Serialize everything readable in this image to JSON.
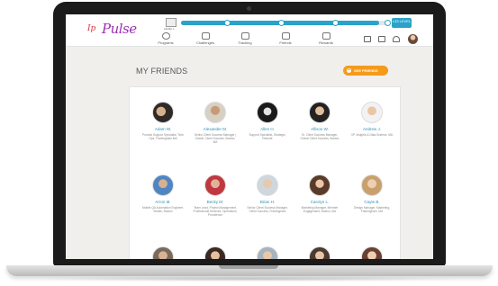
{
  "app": {
    "logo_mark": "Ip",
    "logo_text": "Pulse",
    "level_chip_label": "LEVEL 1",
    "progress_percent": 95,
    "level_badge": "L33 LEVEL"
  },
  "nav": [
    {
      "label": "Programs",
      "icon": "globe-icon"
    },
    {
      "label": "Challenges",
      "icon": "trophy-icon"
    },
    {
      "label": "Tracking",
      "icon": "calendar-icon"
    },
    {
      "label": "Friends",
      "icon": "people-icon"
    },
    {
      "label": "Rewards",
      "icon": "bank-icon"
    }
  ],
  "page": {
    "title": "MY FRIENDS",
    "see_friends_label": "SEE FRIENDS",
    "see_friends_icon": "+"
  },
  "friends": [
    {
      "name": "Adam W.",
      "title": "Product Support Specialist, Tech Ops, Framingham MA"
    },
    {
      "name": "Alexander M.",
      "title": "Senior Client Success Manager | Global, Client Success, Boston, MA"
    },
    {
      "name": "Allen H.",
      "title": "Support Specialist, Strategic, Remote"
    },
    {
      "name": "Allison W.",
      "title": "Sr. Client Success Manager, Global Client Success, Boston"
    },
    {
      "name": "Andrew J.",
      "title": "VP, Insights & Data Science, MA"
    },
    {
      "name": "Arron M.",
      "title": "Mobile QA Automation Engineer, Mobile, Boston"
    },
    {
      "name": "Becky M.",
      "title": "Team Lead, Project Management, Professional Services, Operations, Providence"
    },
    {
      "name": "Brian H.",
      "title": "Senior Client Success Manager, Client Success, Framingham"
    },
    {
      "name": "Carolyn L.",
      "title": "Marketing Manager, Member Engagement, Boston, MA"
    },
    {
      "name": "Cayte B.",
      "title": "Design Manager, Marketing, Framingham, MA"
    }
  ]
}
